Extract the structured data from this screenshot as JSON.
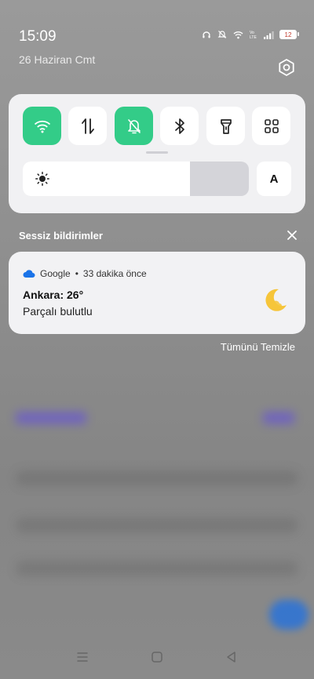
{
  "status": {
    "time": "15:09",
    "date": "26 Haziran Cmt",
    "battery": "12"
  },
  "quick_settings": {
    "tiles": [
      {
        "name": "wifi-icon",
        "active": true
      },
      {
        "name": "mobile-data-icon",
        "active": false
      },
      {
        "name": "silent-mode-icon",
        "active": true
      },
      {
        "name": "bluetooth-icon",
        "active": false
      },
      {
        "name": "flashlight-icon",
        "active": false
      },
      {
        "name": "grid-menu-icon",
        "active": false
      }
    ],
    "brightness_level": 0.74,
    "auto_label": "A"
  },
  "notifications": {
    "section_title": "Sessiz bildirimler",
    "items": [
      {
        "app": "Google",
        "time": "33 dakika önce",
        "title": "Ankara: 26°",
        "body": "Parçalı bulutlu"
      }
    ],
    "clear_all": "Tümünü Temizle"
  },
  "colors": {
    "accent": "#33cc88",
    "panel": "#f1f1f3",
    "weather_icon": "#f6c53a"
  }
}
